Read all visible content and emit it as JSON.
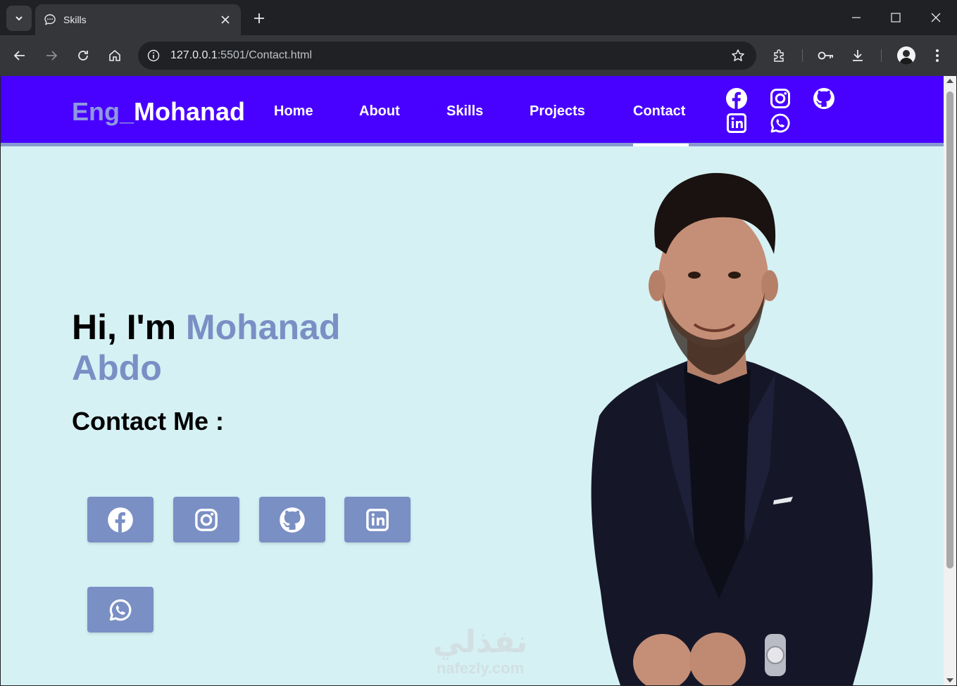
{
  "browser": {
    "tab_title": "Skills",
    "url_host": "127.0.0.1",
    "url_path": ":5501/Contact.html"
  },
  "navbar": {
    "logo_prefix": "Eng_",
    "logo_name": "Mohanad",
    "links": [
      {
        "label": "Home",
        "active": false
      },
      {
        "label": "About",
        "active": false
      },
      {
        "label": "Skills",
        "active": false
      },
      {
        "label": "Projects",
        "active": false
      },
      {
        "label": "Contact",
        "active": true
      }
    ],
    "social_icons": [
      "facebook-icon",
      "instagram-icon",
      "github-icon",
      "linkedin-icon",
      "whatsapp-icon"
    ]
  },
  "hero": {
    "greeting": "Hi, I'm ",
    "name": "Mohanad Abdo",
    "contact_heading": "Contact Me :",
    "buttons": [
      "facebook-icon",
      "instagram-icon",
      "github-icon",
      "linkedin-icon",
      "whatsapp-icon"
    ]
  },
  "watermark": {
    "arabic": "نفذلي",
    "latin": "nafezly.com"
  },
  "colors": {
    "navbar_bg": "#4800ff",
    "navbar_border": "#8798d0",
    "page_bg": "#d5f1f4",
    "accent": "#7a8fc4",
    "logo_prefix": "#8f98e0"
  }
}
